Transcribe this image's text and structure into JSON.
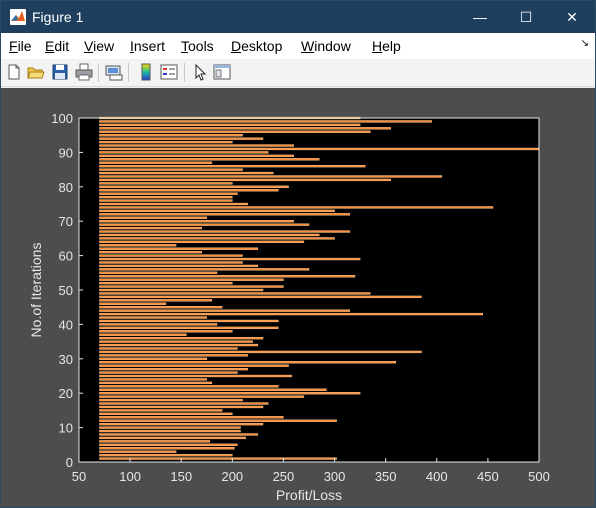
{
  "window": {
    "title": "Figure 1",
    "minimize_glyph": "—",
    "maximize_glyph": "☐",
    "close_glyph": "✕"
  },
  "menu": {
    "items": [
      {
        "label": "File",
        "u": "F",
        "rest": "ile"
      },
      {
        "label": "Edit",
        "u": "E",
        "rest": "dit"
      },
      {
        "label": "View",
        "u": "V",
        "rest": "iew"
      },
      {
        "label": "Insert",
        "u": "I",
        "rest": "nsert"
      },
      {
        "label": "Tools",
        "u": "T",
        "rest": "ools"
      },
      {
        "label": "Desktop",
        "u": "D",
        "rest": "esktop"
      },
      {
        "label": "Window",
        "u": "W",
        "rest": "indow"
      },
      {
        "label": "Help",
        "u": "H",
        "rest": "elp"
      }
    ],
    "dock_glyph": "↘"
  },
  "toolbar": {
    "icons": [
      "new-figure-icon",
      "open-file-icon",
      "save-icon",
      "print-icon",
      "print-preview-icon",
      "colorbar-icon",
      "legend-icon",
      "pointer-icon",
      "property-editor-icon"
    ]
  },
  "colors": {
    "bar_fill": "#ff8c3a",
    "bar_edge": "#ffd9a0",
    "axes_bg": "#000000",
    "figure_bg": "#4d4d4d",
    "axis_text": "#e6e6e6"
  },
  "chart_data": {
    "type": "bar",
    "orientation": "horizontal",
    "xlabel": "Profit/Loss",
    "ylabel": "No.of Iterations",
    "xlim": [
      50,
      500
    ],
    "ylim": [
      0,
      100
    ],
    "xticks": [
      50,
      100,
      150,
      200,
      250,
      300,
      350,
      400,
      450,
      500
    ],
    "yticks": [
      0,
      10,
      20,
      30,
      40,
      50,
      60,
      70,
      80,
      90,
      100
    ],
    "base_value": 70,
    "categories": [
      1,
      2,
      3,
      4,
      5,
      6,
      7,
      8,
      9,
      10,
      11,
      12,
      13,
      14,
      15,
      16,
      17,
      18,
      19,
      20,
      21,
      22,
      23,
      24,
      25,
      26,
      27,
      28,
      29,
      30,
      31,
      32,
      33,
      34,
      35,
      36,
      37,
      38,
      39,
      40,
      41,
      42,
      43,
      44,
      45,
      46,
      47,
      48,
      49,
      50,
      51,
      52,
      53,
      54,
      55,
      56,
      57,
      58,
      59,
      60,
      61,
      62,
      63,
      64,
      65,
      66,
      67,
      68,
      69,
      70,
      71,
      72,
      73,
      74,
      75,
      76,
      77,
      78,
      79,
      80,
      81,
      82,
      83,
      84,
      85,
      86,
      87,
      88,
      89,
      90,
      91,
      92,
      93,
      94,
      95,
      96,
      97,
      98,
      99,
      100
    ],
    "values": [
      302,
      200,
      145,
      202,
      205,
      178,
      213,
      225,
      208,
      208,
      230,
      302,
      250,
      200,
      190,
      230,
      235,
      210,
      270,
      325,
      292,
      245,
      180,
      175,
      258,
      205,
      215,
      255,
      360,
      175,
      215,
      385,
      205,
      225,
      220,
      230,
      155,
      200,
      245,
      185,
      245,
      175,
      445,
      315,
      190,
      135,
      180,
      385,
      335,
      230,
      250,
      200,
      250,
      320,
      185,
      275,
      225,
      210,
      325,
      210,
      170,
      225,
      145,
      270,
      300,
      285,
      315,
      170,
      275,
      260,
      175,
      315,
      300,
      455,
      215,
      200,
      200,
      205,
      245,
      255,
      200,
      355,
      405,
      240,
      210,
      330,
      180,
      285,
      260,
      235,
      500,
      260,
      200,
      230,
      210,
      335,
      355,
      325,
      395,
      325
    ]
  }
}
